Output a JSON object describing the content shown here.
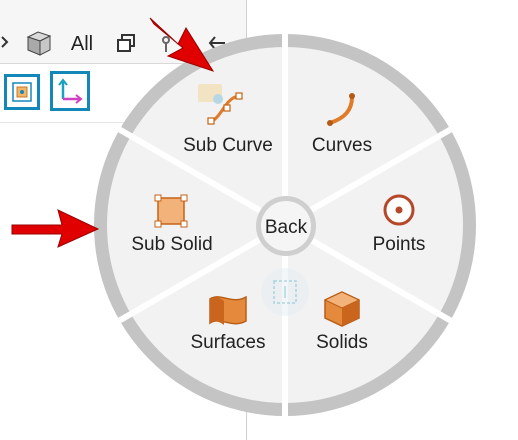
{
  "toolbar": {
    "all_label": "All",
    "icons": [
      "chevron-icon",
      "cube-view-icon",
      "copy-windows-icon",
      "pin-icon",
      "back-arrow-icon"
    ],
    "row2_icons": [
      "snap-view-icon",
      "axes-icon"
    ]
  },
  "pie_menu": {
    "center_label": "Back",
    "items": [
      {
        "label": "Sub Curve",
        "icon": "sub-curve-icon"
      },
      {
        "label": "Curves",
        "icon": "curves-icon"
      },
      {
        "label": "Points",
        "icon": "points-icon"
      },
      {
        "label": "Solids",
        "icon": "solids-icon"
      },
      {
        "label": "Surfaces",
        "icon": "surfaces-icon"
      },
      {
        "label": "Sub Solid",
        "icon": "sub-solid-icon"
      }
    ],
    "colors": {
      "ring": "#c4c4c4",
      "wedge_fill": "#f2f2f2",
      "icon_orange": "#e07b2a",
      "icon_orange_light": "#f3b27a",
      "points_red": "#b5472a",
      "arrow_red": "#e00000",
      "blue_frame": "#1388b8"
    }
  }
}
